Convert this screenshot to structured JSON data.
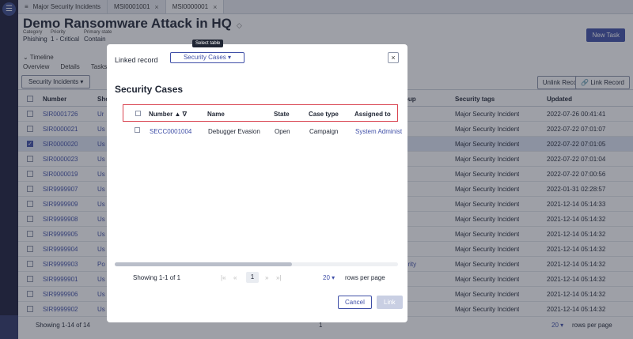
{
  "tabs": [
    {
      "label": "Major Security Incidents"
    },
    {
      "label": "MSI0001001"
    },
    {
      "label": "MSI0000001"
    }
  ],
  "record": {
    "title": "Demo Ransomware Attack in HQ",
    "category_label": "Category",
    "category_value": "Phishing",
    "priority_label": "Priority",
    "priority_value": "1 - Critical",
    "state_label": "Primary state",
    "state_value": "Contain",
    "new_task": "New Task",
    "timeline": "Timeline",
    "subtabs": [
      "Overview",
      "Details",
      "Tasks"
    ]
  },
  "related": {
    "selector": "Security Incidents",
    "unlink": "Unlink Record",
    "link": "Link Record",
    "columns": {
      "number": "Number",
      "short": "Sho",
      "group": "oup",
      "tags": "Security tags",
      "updated": "Updated"
    },
    "rows": [
      {
        "number": "SIR0001726",
        "short": "Ur",
        "group": "",
        "tags": "Major Security Incident",
        "updated": "2022-07-26 00:41:41",
        "checked": false
      },
      {
        "number": "SIR0000021",
        "short": "Us",
        "group": "",
        "tags": "Major Security Incident",
        "updated": "2022-07-22 07:01:07",
        "checked": false
      },
      {
        "number": "SIR0000020",
        "short": "Us",
        "group": "",
        "tags": "Major Security Incident",
        "updated": "2022-07-22 07:01:05",
        "checked": true
      },
      {
        "number": "SIR0000023",
        "short": "Us",
        "group": "",
        "tags": "Major Security Incident",
        "updated": "2022-07-22 07:01:04",
        "checked": false
      },
      {
        "number": "SIR0000019",
        "short": "Us",
        "group": "",
        "tags": "Major Security Incident",
        "updated": "2022-07-22 07:00:56",
        "checked": false
      },
      {
        "number": "SIR9999907",
        "short": "Us",
        "group": "",
        "tags": "Major Security Incident",
        "updated": "2022-01-31 02:28:57",
        "checked": false
      },
      {
        "number": "SIR9999909",
        "short": "Us",
        "group": "",
        "tags": "Major Security Incident",
        "updated": "2021-12-14 05:14:33",
        "checked": false
      },
      {
        "number": "SIR9999908",
        "short": "Us",
        "group": "",
        "tags": "Major Security Incident",
        "updated": "2021-12-14 05:14:32",
        "checked": false
      },
      {
        "number": "SIR9999905",
        "short": "Us",
        "group": "",
        "tags": "Major Security Incident",
        "updated": "2021-12-14 05:14:32",
        "checked": false
      },
      {
        "number": "SIR9999904",
        "short": "Us",
        "group": "",
        "tags": "Major Security Incident",
        "updated": "2021-12-14 05:14:32",
        "checked": false
      },
      {
        "number": "SIR9999903",
        "short": "Po",
        "group": "urity",
        "tags": "Major Security Incident",
        "updated": "2021-12-14 05:14:32",
        "checked": false
      },
      {
        "number": "SIR9999901",
        "short": "Us",
        "group": "",
        "tags": "Major Security Incident",
        "updated": "2021-12-14 05:14:32",
        "checked": false
      },
      {
        "number": "SIR9999906",
        "short": "Us",
        "group": "",
        "tags": "Major Security Incident",
        "updated": "2021-12-14 05:14:32",
        "checked": false
      },
      {
        "number": "SIR9999902",
        "short": "Us",
        "group": "",
        "tags": "Major Security Incident",
        "updated": "2021-12-14 05:14:32",
        "checked": false
      }
    ],
    "footer_showing": "Showing 1-14 of 14",
    "footer_page": "1",
    "footer_rows": "20",
    "footer_rows_label": "rows per page"
  },
  "modal": {
    "title": "Linked record",
    "select_value": "Security Cases",
    "tooltip": "Select table",
    "heading": "Security Cases",
    "columns": {
      "number": "Number",
      "name": "Name",
      "state": "State",
      "case_type": "Case type",
      "assigned_to": "Assigned to"
    },
    "rows": [
      {
        "number": "SECC0001004",
        "name": "Debugger Evasion",
        "state": "Open",
        "case_type": "Campaign",
        "assigned_to": "System Administ"
      }
    ],
    "showing": "Showing 1-1 of 1",
    "page": "1",
    "rows_per_page": "20",
    "rows_per_page_label": "rows per page",
    "cancel": "Cancel",
    "link": "Link"
  }
}
